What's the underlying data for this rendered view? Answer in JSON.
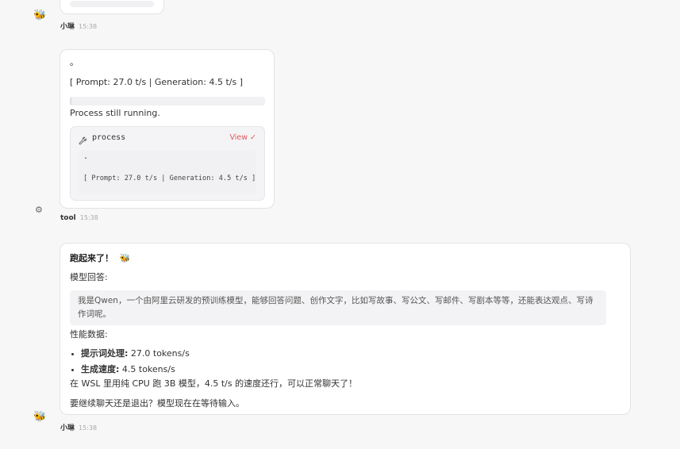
{
  "messages": [
    {
      "sender": "小琳",
      "time": "15:38",
      "avatar_icon": "bee-icon"
    },
    {
      "sender": "tool",
      "time": "15:38",
      "avatar_icon": "gear-icon",
      "dot": "。",
      "stats_line": "[ Prompt: 27.0 t/s | Generation: 4.5 t/s ]",
      "status": "Process still running.",
      "tool": {
        "name": "process",
        "view_label": "View",
        "output_dot": ".",
        "output_line": "[ Prompt: 27.0 t/s | Generation: 4.5 t/s ]"
      }
    },
    {
      "sender": "小琳",
      "time": "15:38",
      "avatar_icon": "bee-icon",
      "heading": "跑起来了！",
      "model_label": "模型回答:",
      "quote": "我是Qwen，一个由阿里云研发的预训练模型，能够回答问题、创作文字，比如写故事、写公文、写邮件、写剧本等等，还能表达观点、写诗作词呢。",
      "perf_label": "性能数据:",
      "perf_items": [
        {
          "key": "提示词处理:",
          "value": " 27.0 tokens/s"
        },
        {
          "key": "生成速度:",
          "value": " 4.5 tokens/s"
        }
      ],
      "summary": "在 WSL 里用纯 CPU 跑 3B 模型，4.5 t/s 的速度还行，可以正常聊天了！",
      "question": "要继续聊天还是退出？模型现在在等待输入。"
    }
  ]
}
